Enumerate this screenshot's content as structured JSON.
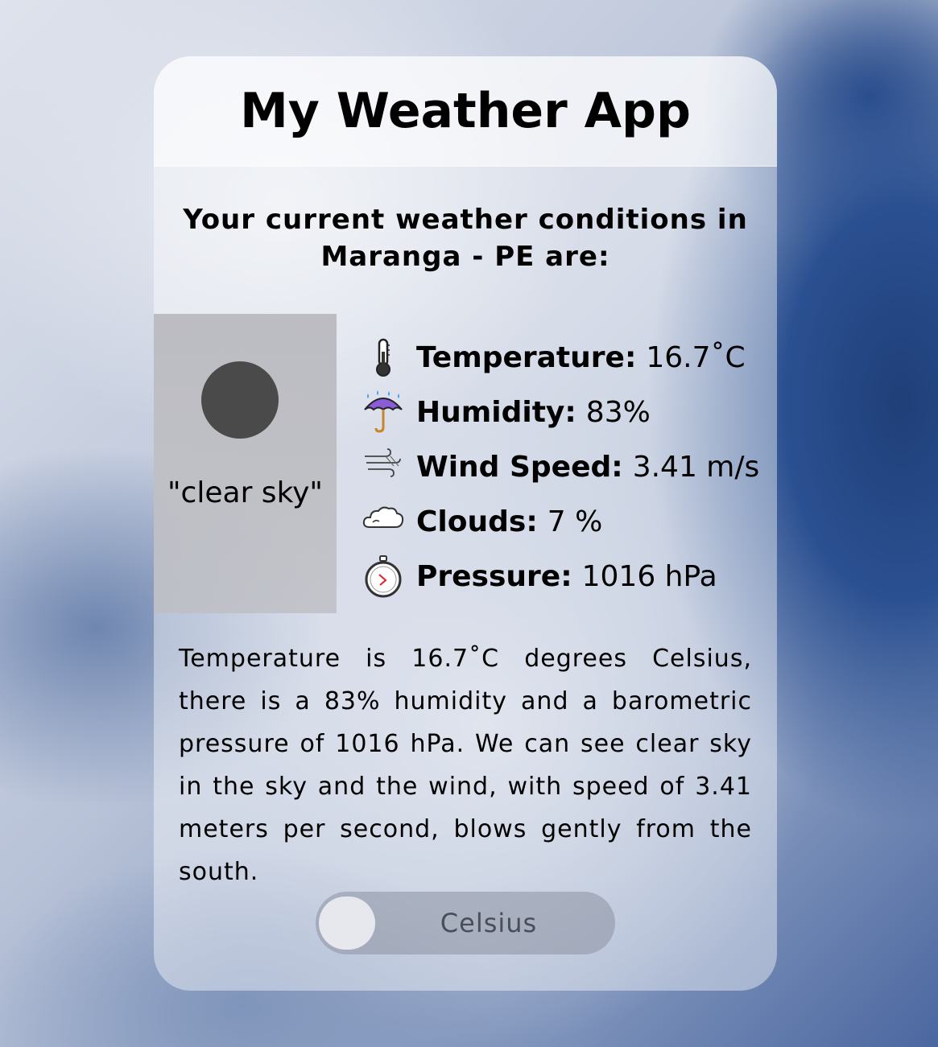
{
  "app": {
    "title": "My Weather App"
  },
  "location": {
    "heading_line1": "Your current weather conditions in",
    "heading_line2": "Maranga - PE are:"
  },
  "sky": {
    "description": "\"clear sky\""
  },
  "stats": [
    {
      "icon": "thermometer-icon",
      "label": "Temperature:",
      "value": "16.7˚C"
    },
    {
      "icon": "umbrella-rain-icon",
      "label": "Humidity:",
      "value": "83%"
    },
    {
      "icon": "wind-icon",
      "label": "Wind Speed:",
      "value": "3.41 m/s"
    },
    {
      "icon": "cloud-icon",
      "label": "Clouds:",
      "value": "7 %"
    },
    {
      "icon": "stopwatch-icon",
      "label": "Pressure:",
      "value": "1016 hPa"
    }
  ],
  "summary": {
    "text": "Temperature is 16.7˚C degrees Celsius, there is a 83% humidity and a barometric pressure of 1016 hPa. We can see clear sky in the sky and the wind, with speed of 3.41 meters per second, blows gently from the south."
  },
  "unit_toggle": {
    "label": "Celsius",
    "state": "off"
  },
  "colors": {
    "card_background": "rgba(255,255,255,0.42)",
    "sky_panel": "#bdbdc2",
    "sun": "#4a4a4a",
    "toggle_track": "#8c91a0",
    "toggle_knob": "#e6e8ee",
    "toggle_text": "#4a4e58"
  }
}
